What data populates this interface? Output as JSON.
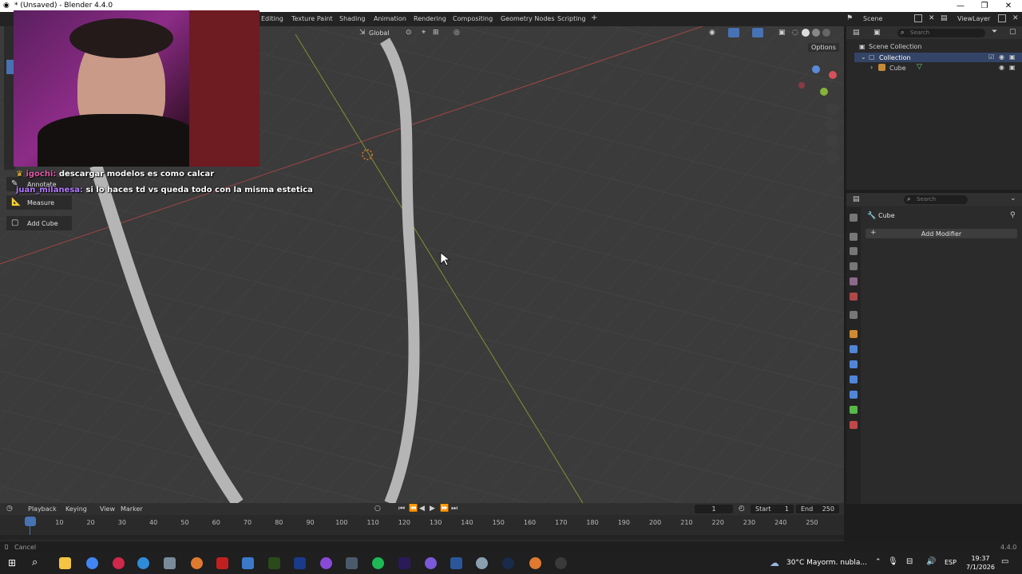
{
  "window": {
    "title": "* (Unsaved) - Blender 4.4.0",
    "minimize": "—",
    "maximize": "❐",
    "close": "✕"
  },
  "workspaces": [
    "Editing",
    "Texture Paint",
    "Shading",
    "Animation",
    "Rendering",
    "Compositing",
    "Geometry Nodes",
    "Scripting"
  ],
  "add_workspace": "+",
  "scene": {
    "name": "Scene",
    "view_layer": "ViewLayer"
  },
  "viewport": {
    "orientation": "Global",
    "options_label": "Options"
  },
  "tools": {
    "annotate": "Annotate",
    "measure": "Measure",
    "add_cube": "Add Cube"
  },
  "chat": [
    {
      "user": "igochi:",
      "message": "descargar modelos es como calcar",
      "user_color": "#e05aa8"
    },
    {
      "user": "juan_milanesa:",
      "message": "si lo haces td vs queda todo con la misma estetica",
      "user_color": "#b57bff"
    }
  ],
  "outliner": {
    "search_placeholder": "Search",
    "root": "Scene Collection",
    "collection": "Collection",
    "object": "Cube"
  },
  "properties": {
    "search_placeholder": "Search",
    "object_name": "Cube",
    "add_modifier": "Add Modifier"
  },
  "timeline": {
    "menus": [
      "Playback",
      "Keying",
      "View",
      "Marker"
    ],
    "current_frame": "1",
    "start_label": "Start",
    "start_value": "1",
    "end_label": "End",
    "end_value": "250",
    "frames": [
      "1",
      "10",
      "20",
      "30",
      "40",
      "50",
      "60",
      "70",
      "80",
      "90",
      "100",
      "110",
      "120",
      "130",
      "140",
      "150",
      "160",
      "170",
      "180",
      "190",
      "200",
      "210",
      "220",
      "230",
      "240",
      "250"
    ]
  },
  "status": {
    "left": "Cancel",
    "version": "4.4.0"
  },
  "taskbar": {
    "weather": "30°C  Mayorm. nubla...",
    "lang": "ESP",
    "time": "19:37",
    "date": "7/1/2026"
  },
  "colors": {
    "accent": "#4772b3",
    "x_axis": "#c84848",
    "y_axis": "#8ea53a"
  }
}
